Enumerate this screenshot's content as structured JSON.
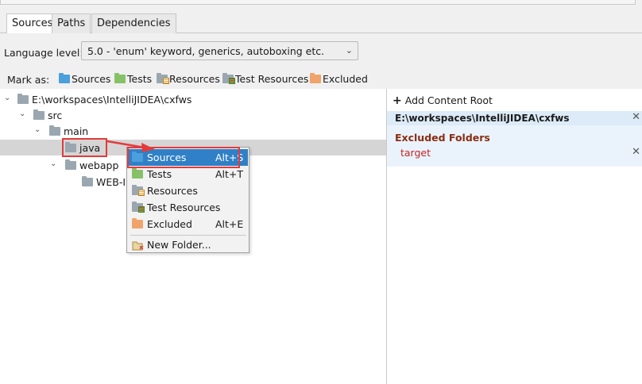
{
  "tabs": [
    {
      "label": "Sources",
      "active": true
    },
    {
      "label": "Paths",
      "active": false
    },
    {
      "label": "Dependencies",
      "active": false
    }
  ],
  "language": {
    "label": "Language level:",
    "value": "5.0 - 'enum' keyword, generics, autoboxing etc."
  },
  "mark_as": {
    "label": "Mark as:",
    "items": [
      {
        "label": "Sources",
        "icon": "sources-folder-icon"
      },
      {
        "label": "Tests",
        "icon": "tests-folder-icon"
      },
      {
        "label": "Resources",
        "icon": "resources-folder-icon"
      },
      {
        "label": "Test Resources",
        "icon": "test-resources-folder-icon"
      },
      {
        "label": "Excluded",
        "icon": "excluded-folder-icon"
      }
    ]
  },
  "tree": {
    "nodes": [
      {
        "label": "E:\\workspaces\\IntelliJIDEA\\cxfws",
        "expanded": true
      },
      {
        "label": "src",
        "expanded": true
      },
      {
        "label": "main",
        "expanded": true
      },
      {
        "label": "java",
        "selected": true
      },
      {
        "label": "webapp",
        "expanded": true
      },
      {
        "label": "WEB-INF"
      }
    ]
  },
  "right_panel": {
    "add_content_root": "Add Content Root",
    "root_path": "E:\\workspaces\\IntelliJIDEA\\cxfws",
    "excluded_title": "Excluded Folders",
    "excluded_items": [
      "target"
    ]
  },
  "context_menu": {
    "items": [
      {
        "label": "Sources",
        "shortcut": "Alt+S",
        "highlighted": true
      },
      {
        "label": "Tests",
        "shortcut": "Alt+T"
      },
      {
        "label": "Resources",
        "shortcut": ""
      },
      {
        "label": "Test Resources",
        "shortcut": ""
      },
      {
        "label": "Excluded",
        "shortcut": "Alt+E"
      },
      {
        "label": "New Folder...",
        "shortcut": ""
      }
    ]
  },
  "colors": {
    "sources": "#4a9fdc",
    "tests": "#87c167",
    "excluded": "#f0a46b",
    "highlight": "#2f80c6",
    "annotation": "#e33b3b"
  }
}
